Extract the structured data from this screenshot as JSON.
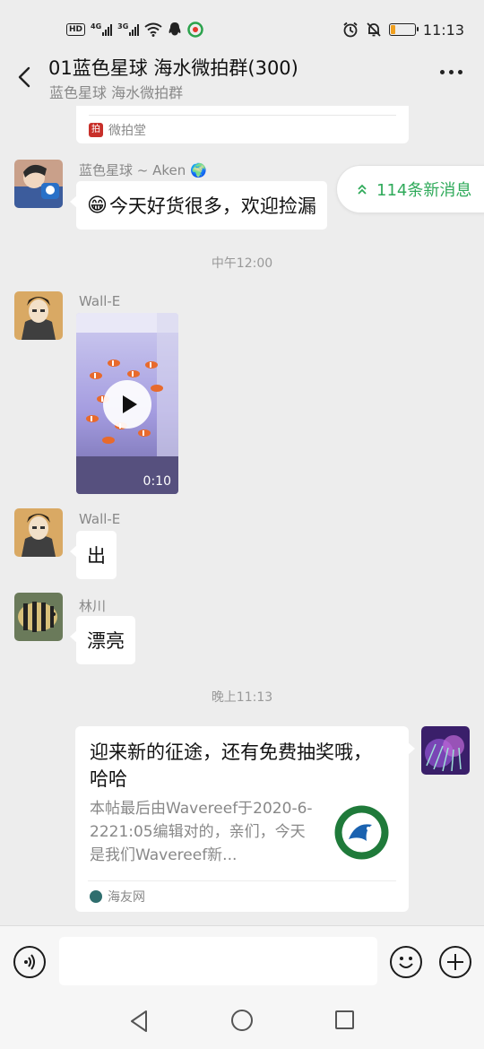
{
  "status_bar": {
    "network": [
      "4G",
      "3G"
    ],
    "time": "11:13",
    "battery_percent": 20,
    "battery_color": "#f0a020",
    "icons": [
      "hd-icon",
      "signal-4g-icon",
      "signal-3g-icon",
      "wifi-icon",
      "qq-icon",
      "app-icon",
      "alarm-icon",
      "mute-bell-icon",
      "battery-icon"
    ]
  },
  "header": {
    "title": "01蓝色星球 海水微拍群(300)",
    "subtitle": "蓝色星球 海水微拍群",
    "back_icon": "chevron-left-icon",
    "more_icon": "more-dots-icon"
  },
  "new_messages": {
    "label": "114条新消息",
    "icon": "double-chevron-up-icon",
    "color": "#2faa5a"
  },
  "chat": {
    "top_card_source": "微拍堂",
    "messages": [
      {
        "sender": "蓝色星球 ~ Aken 🌍",
        "emoji": "😁",
        "text": "今天好货很多，欢迎捡漏"
      },
      {
        "timestamp": "中午12:00"
      },
      {
        "sender": "Wall-E",
        "type": "video",
        "duration": "0:10"
      },
      {
        "sender": "Wall-E",
        "text": "出"
      },
      {
        "sender": "林川",
        "text": "漂亮"
      },
      {
        "timestamp": "晚上11:13"
      },
      {
        "type": "link",
        "self": true,
        "title": "迎来新的征途，还有免费抽奖哦，哈哈",
        "description": "本帖最后由Wavereef于2020-6-2221:05编辑对的，亲们，今天是我们Wavereef新...",
        "source": "海友网"
      }
    ]
  },
  "input_bar": {
    "voice_icon": "voice-icon",
    "emoji_icon": "emoji-icon",
    "plus_icon": "plus-icon",
    "placeholder": ""
  },
  "nav_bar": {
    "icons": [
      "nav-back-icon",
      "nav-home-icon",
      "nav-recent-icon"
    ]
  }
}
